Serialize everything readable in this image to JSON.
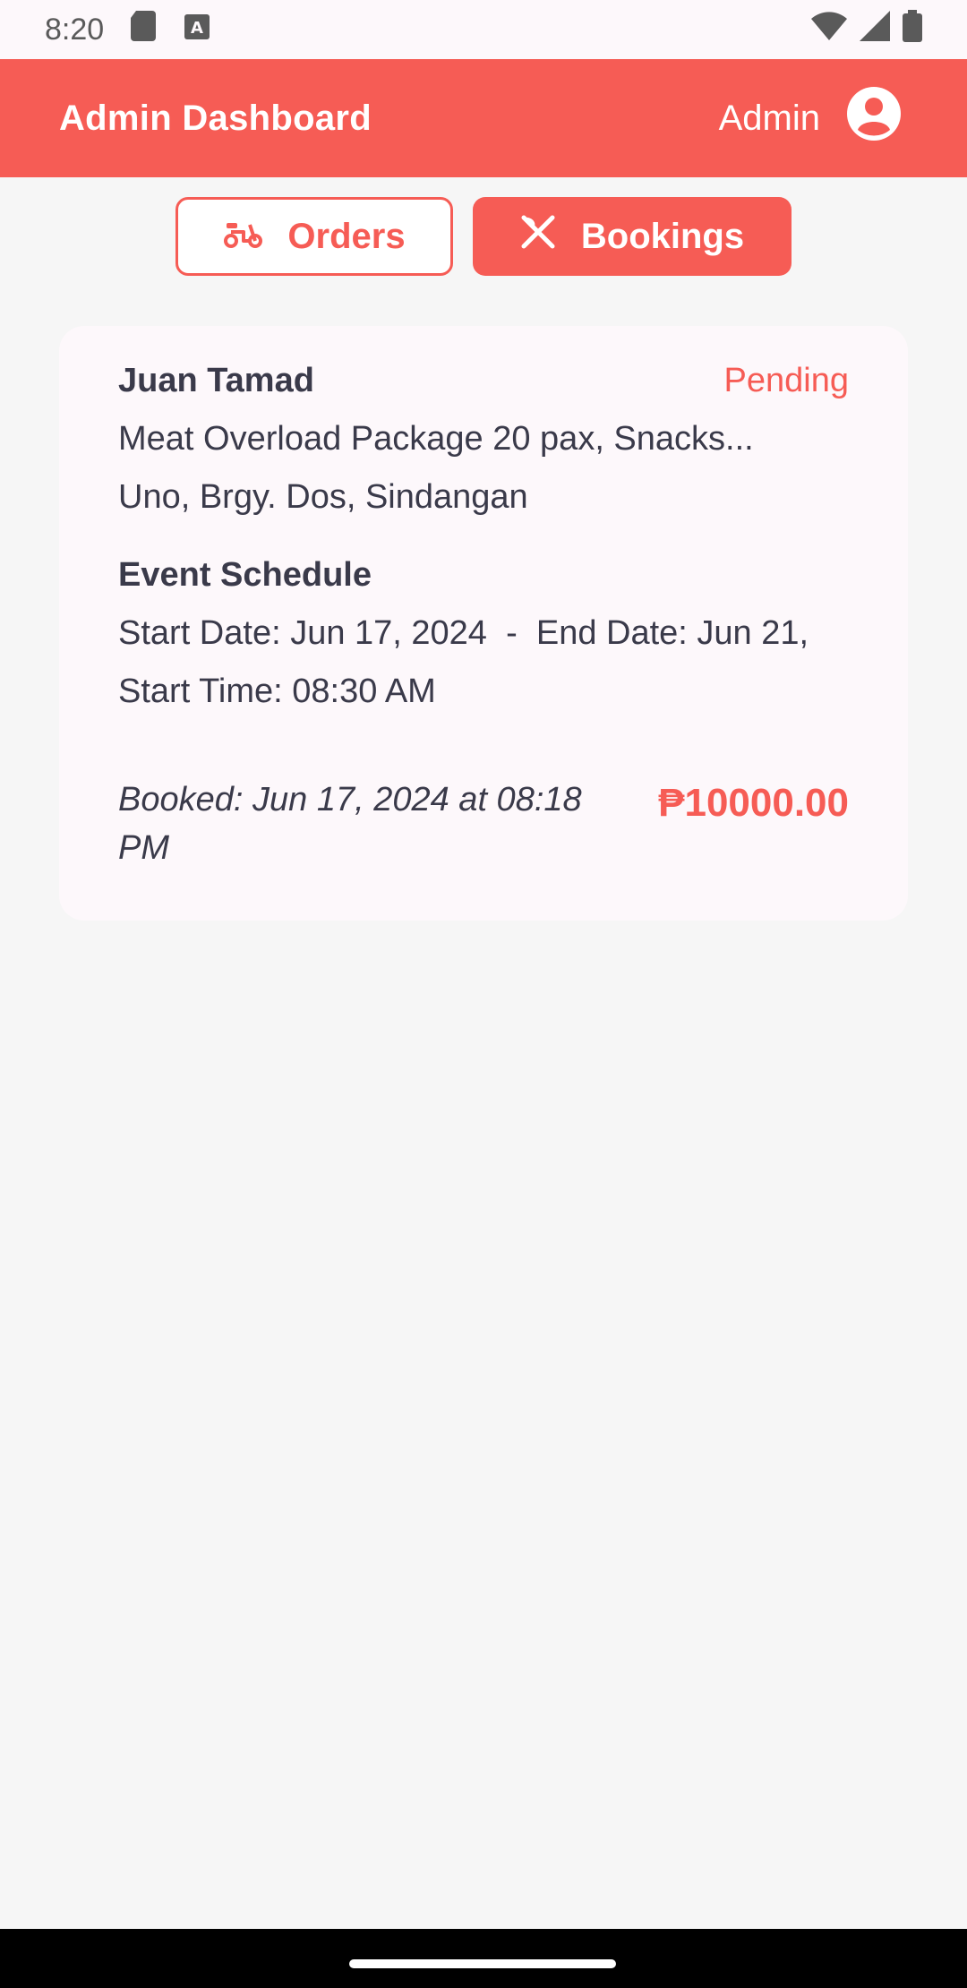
{
  "statusbar": {
    "time": "8:20"
  },
  "appbar": {
    "title": "Admin Dashboard",
    "user_label": "Admin"
  },
  "tabs": [
    {
      "label": "Orders",
      "icon": "scooter-icon",
      "selected": false
    },
    {
      "label": "Bookings",
      "icon": "fork-knife-icon",
      "selected": true
    }
  ],
  "booking": {
    "customer": "Juan Tamad",
    "status": "Pending",
    "package": "Meat Overload Package 20 pax, Snacks...",
    "address": "Uno, Brgy. Dos, Sindangan",
    "schedule_title": "Event Schedule",
    "start_date": "Start Date: Jun 17, 2024",
    "date_separator": "-",
    "end_date": "End Date: Jun 21,",
    "start_time": "Start Time: 08:30 AM",
    "booked_label": "Booked",
    "booked_value": ": Jun 17, 2024 at 08:18 PM",
    "price": "₱10000.00"
  },
  "colors": {
    "accent": "#f65c55",
    "background": "#f6f6f6",
    "card": "#fdf8fb"
  }
}
